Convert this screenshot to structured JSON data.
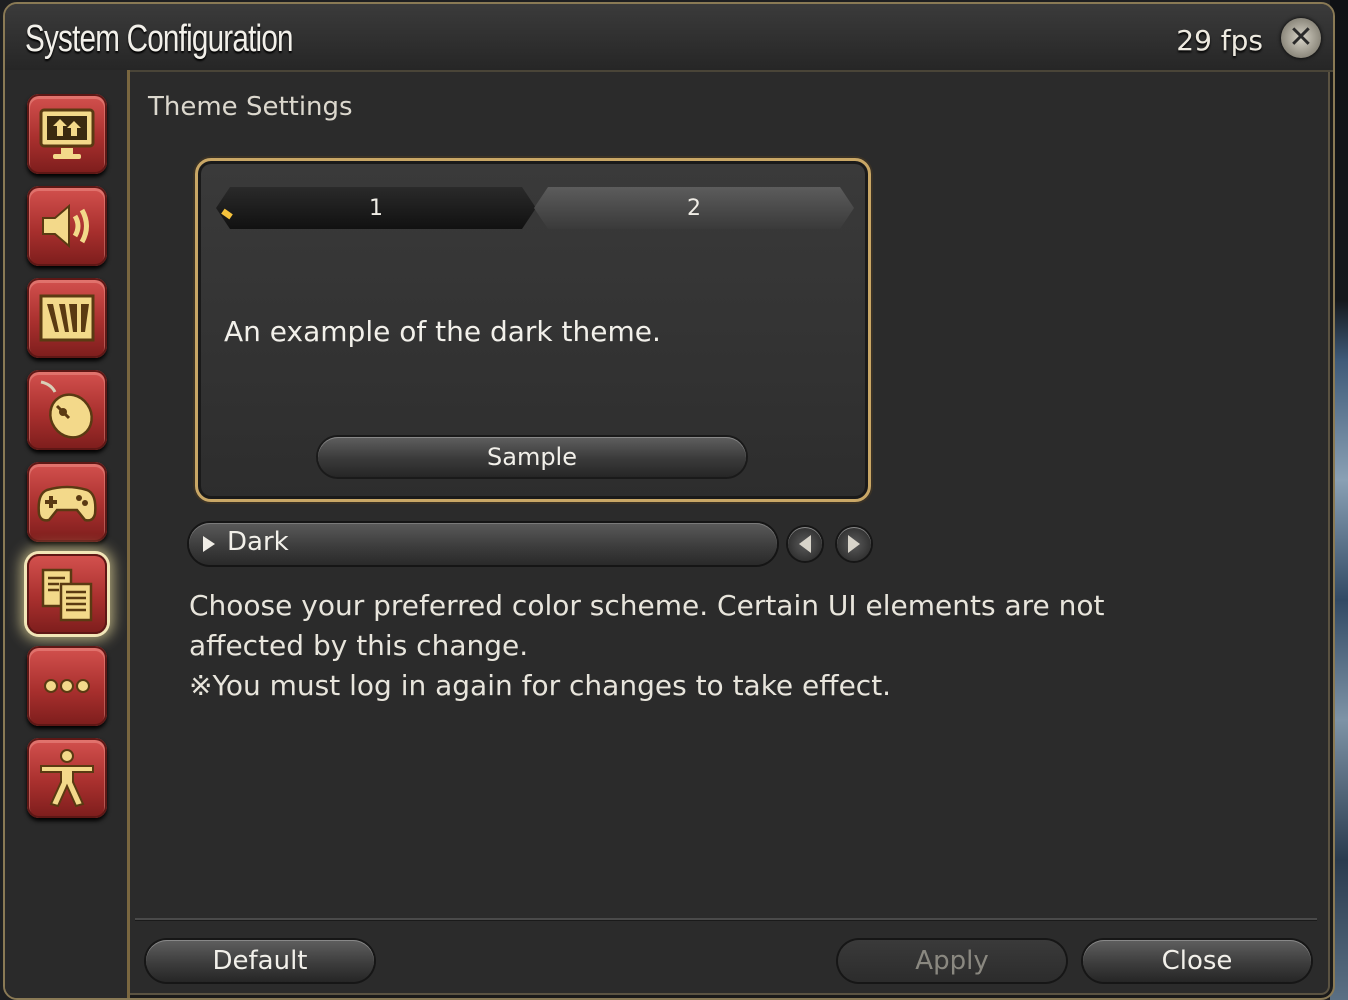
{
  "window": {
    "title": "System Configuration",
    "fps": "29 fps",
    "close_icon": "close-x-icon"
  },
  "sidebar": {
    "items": [
      {
        "icon": "display-settings-icon",
        "active": false
      },
      {
        "icon": "sound-settings-icon",
        "active": false
      },
      {
        "icon": "graphics-settings-icon",
        "active": false
      },
      {
        "icon": "mouse-settings-icon",
        "active": false
      },
      {
        "icon": "gamepad-settings-icon",
        "active": false
      },
      {
        "icon": "theme-settings-icon",
        "active": true
      },
      {
        "icon": "other-settings-icon",
        "active": false
      },
      {
        "icon": "accessibility-icon",
        "active": false
      }
    ]
  },
  "main": {
    "section_title": "Theme Settings",
    "preview": {
      "tabs": [
        "1",
        "2"
      ],
      "active_tab": "1",
      "example_text": "An example of the dark theme.",
      "sample_label": "Sample"
    },
    "theme_select": {
      "value": "Dark"
    },
    "description": [
      "Choose your preferred color scheme. Certain UI elements are not",
      "affected by this change.",
      "※You must log in again for changes to take effect."
    ]
  },
  "footer": {
    "default_label": "Default",
    "apply_label": "Apply",
    "close_label": "Close"
  },
  "colors": {
    "accent_gold": "#c9a766",
    "nav_red": "#a9302e",
    "background": "#2b2b2b"
  }
}
